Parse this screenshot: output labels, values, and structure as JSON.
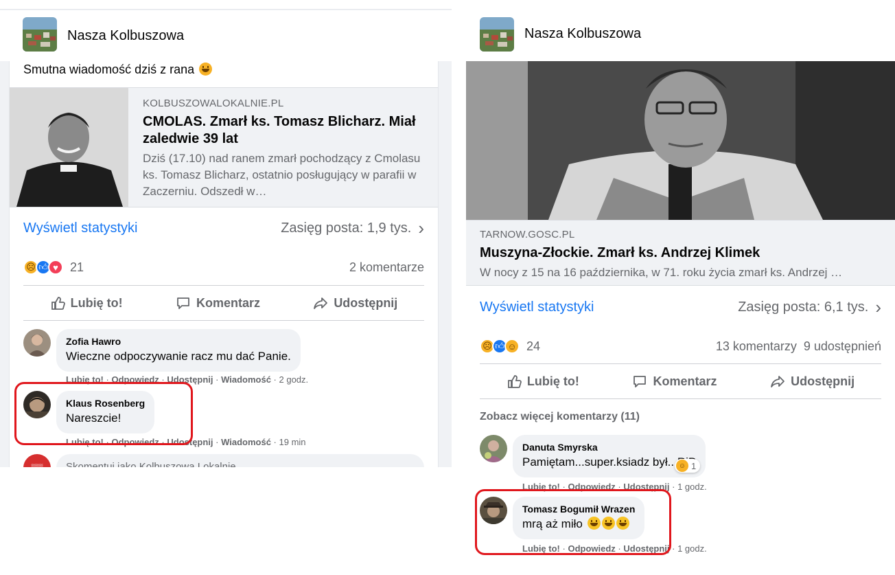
{
  "left": {
    "group_name": "Nasza Kolbuszowa",
    "post_text": "Smutna wiadomość dziś z rana",
    "link": {
      "domain": "KOLBUSZOWALOKALNIE.PL",
      "title": "CMOLAS. Zmarł ks. Tomasz Blicharz. Miał zaledwie 39 lat",
      "description": "Dziś (17.10) nad ranem zmarł pochodzący z Cmolasu ks. Tomasz Blicharz, ostatnio posługujący w parafii w Zaczerniu. Odszedł w…"
    },
    "stats_link": "Wyświetl statystyki",
    "reach": "Zasięg posta: 1,9 tys.",
    "reaction_count": "21",
    "comments_count": "2 komentarze",
    "actions": {
      "like": "Lubię to!",
      "comment": "Komentarz",
      "share": "Udostępnij"
    },
    "comments": [
      {
        "author": "Zofia Hawro",
        "text": "Wieczne odpoczywanie racz mu dać Panie.",
        "like": "Lubię to!",
        "reply": "Odpowiedz",
        "share": "Udostępnij",
        "message": "Wiadomość",
        "time": "2 godz."
      },
      {
        "author": "Klaus Rosenberg",
        "text": "Nareszcie!",
        "like": "Lubię to!",
        "reply": "Odpowiedz",
        "share": "Udostępnij",
        "message": "Wiadomość",
        "time": "19 min"
      }
    ],
    "input_placeholder": "Skomentuj jako Kolbuszowa Lokalnie"
  },
  "right": {
    "group_name": "Nasza Kolbuszowa",
    "link": {
      "domain": "TARNOW.GOSC.PL",
      "title": "Muszyna-Złockie. Zmarł ks. Andrzej Klimek",
      "description": "W nocy z 15 na 16 października, w 71. roku życia zmarł ks. Andrzej …"
    },
    "stats_link": "Wyświetl statystyki",
    "reach": "Zasięg posta: 6,1 tys.",
    "reaction_count": "24",
    "comments_count": "13 komentarzy",
    "shares_count": "9 udostępnień",
    "actions": {
      "like": "Lubię to!",
      "comment": "Komentarz",
      "share": "Udostępnij"
    },
    "more_comments": "Zobacz więcej komentarzy (11)",
    "comments": [
      {
        "author": "Danuta Smyrska",
        "text": "Pamiętam...super.ksiadz był...RiP",
        "badge_count": "1",
        "like": "Lubię to!",
        "reply": "Odpowiedz",
        "share": "Udostępnij",
        "time": "1 godz."
      },
      {
        "author": "Tomasz Bogumił Wrazen",
        "text": "mrą aż miło",
        "like": "Lubię to!",
        "reply": "Odpowiedz",
        "share": "Udostępnij",
        "time": "1 godz."
      }
    ]
  },
  "colors": {
    "link_blue": "#1877f2",
    "muted": "#65676b",
    "highlight_red": "#e0161c",
    "bubble": "#f0f2f5"
  },
  "icons": {
    "like": "thumbs-up-icon",
    "comment": "speech-bubble-icon",
    "share": "share-arrow-icon",
    "chevron": "chevron-right-icon"
  }
}
